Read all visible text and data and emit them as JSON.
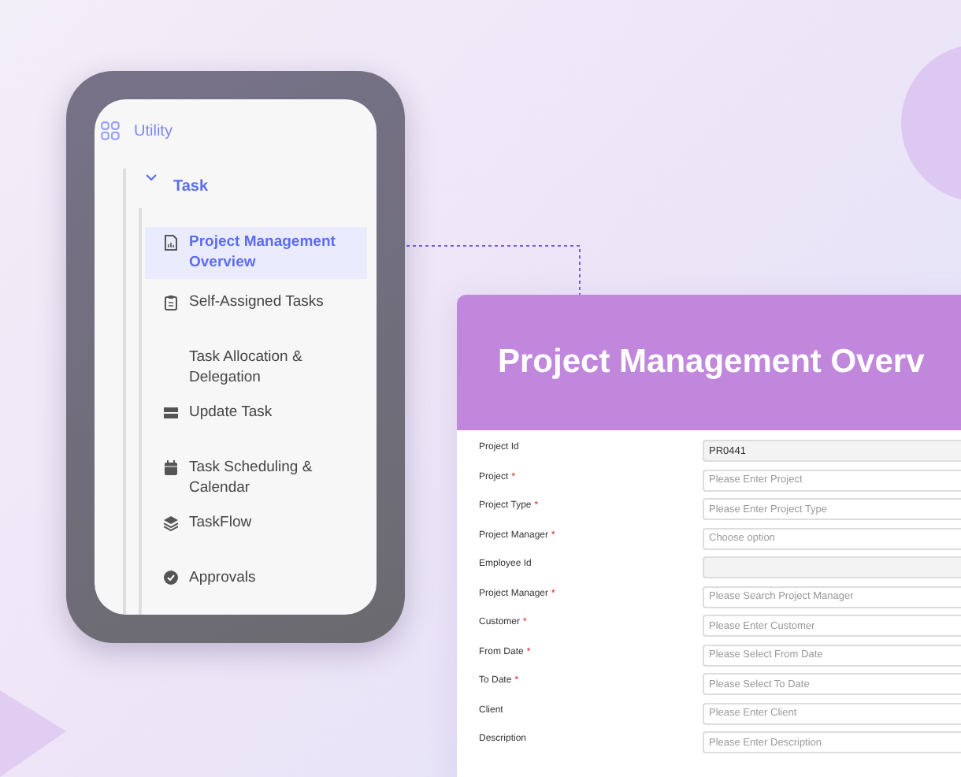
{
  "sidebar": {
    "section": "Utility",
    "group": {
      "label": "Task",
      "expanded": true,
      "items": [
        {
          "label": "Project Management Overview",
          "kind": "document",
          "selected": true
        },
        {
          "label": "Self-Assigned Tasks",
          "kind": "clipboard",
          "selected": false
        },
        {
          "label": "Task Allocation & Delegation",
          "kind": "plain",
          "selected": false
        },
        {
          "label": "Update Task",
          "kind": "server",
          "selected": false
        },
        {
          "label": "Task Scheduling & Calendar",
          "kind": "calendar",
          "selected": false
        },
        {
          "label": "TaskFlow",
          "kind": "layers",
          "selected": false
        },
        {
          "label": "Approvals",
          "kind": "check",
          "selected": false
        }
      ]
    }
  },
  "form": {
    "title": "Project Management Overv",
    "fields": [
      {
        "label": "Project Id",
        "value": "PR0441",
        "disabled": true
      },
      {
        "label": "Project",
        "required_mark": "*",
        "placeholder": "Please Enter Project",
        "disabled": false
      },
      {
        "label": "Project Type",
        "required_mark": "*",
        "placeholder": "Please Enter Project Type",
        "disabled": false
      },
      {
        "label": "Project Manager",
        "required_mark": "*",
        "placeholder": "Choose option",
        "disabled": false
      },
      {
        "label": "Employee Id",
        "disabled": true
      },
      {
        "label": "Project Manager",
        "required_mark": "*",
        "placeholder": "Please Search Project Manager",
        "disabled": false
      },
      {
        "label": "Customer",
        "required_mark": "*",
        "placeholder": "Please Enter Customer",
        "disabled": false
      },
      {
        "label": "From Date",
        "required_mark": "*",
        "placeholder": "Please Select From Date",
        "disabled": false
      },
      {
        "label": "To Date",
        "required_mark": "*",
        "placeholder": "Please Select To Date",
        "disabled": false
      },
      {
        "label": "Client",
        "placeholder": "Please Enter Client",
        "disabled": false
      },
      {
        "label": "Description",
        "placeholder": "Please Enter Description",
        "disabled": false
      }
    ]
  }
}
